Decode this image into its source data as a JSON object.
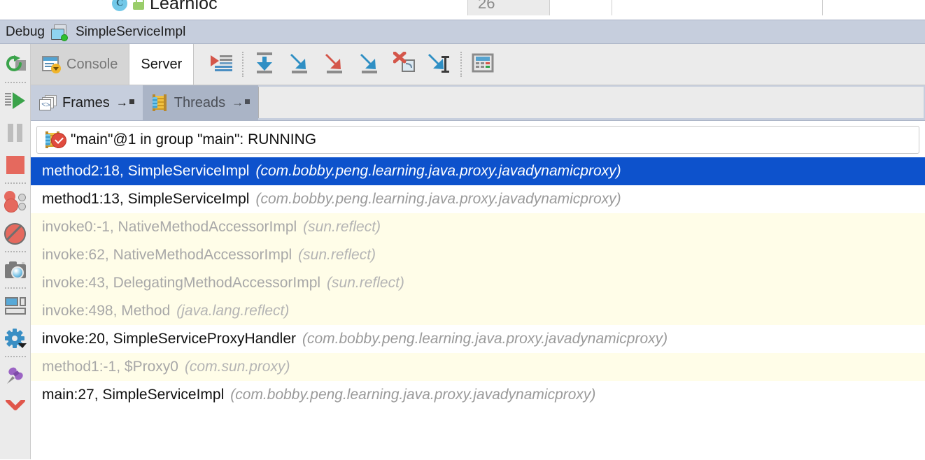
{
  "editor_strip": {
    "class_icon": "class-c-icon",
    "lock_icon": "lock-icon",
    "class_name": "Learnloc",
    "line_number": "26"
  },
  "debug_header": {
    "label": "Debug",
    "session_icon": "debug-session-icon",
    "session_name": "SimpleServiceImpl"
  },
  "side_toolbar": {
    "buttons": [
      {
        "name": "rerun-button",
        "tooltip": "Rerun"
      },
      {
        "name": "resume-program-button",
        "tooltip": "Resume Program"
      },
      {
        "name": "pause-program-button",
        "tooltip": "Pause Program"
      },
      {
        "name": "stop-button",
        "tooltip": "Stop"
      },
      {
        "name": "view-breakpoints-button",
        "tooltip": "View Breakpoints"
      },
      {
        "name": "mute-breakpoints-button",
        "tooltip": "Mute Breakpoints"
      },
      {
        "name": "snapshot-button",
        "tooltip": "Get Thread Dump"
      },
      {
        "name": "restore-layout-button",
        "tooltip": "Restore Layout"
      },
      {
        "name": "settings-button",
        "tooltip": "Settings"
      },
      {
        "name": "pin-tab-button",
        "tooltip": "Pin Tab"
      },
      {
        "name": "collapse-button",
        "tooltip": "Hide"
      }
    ]
  },
  "tabs": {
    "items": [
      {
        "label": "Console",
        "icon": "console-icon",
        "active": false
      },
      {
        "label": "Server",
        "icon": "",
        "active": true
      }
    ]
  },
  "toolbar": {
    "buttons": [
      {
        "name": "show-execution-point-button",
        "label": "Show Execution Point"
      },
      {
        "name": "step-over-button",
        "label": "Step Over"
      },
      {
        "name": "step-into-button",
        "label": "Step Into"
      },
      {
        "name": "force-step-into-button",
        "label": "Force Step Into"
      },
      {
        "name": "step-out-button",
        "label": "Step Out"
      },
      {
        "name": "drop-frame-button",
        "label": "Drop Frame"
      },
      {
        "name": "run-to-cursor-button",
        "label": "Run to Cursor"
      },
      {
        "name": "evaluate-expression-button",
        "label": "Evaluate Expression"
      }
    ]
  },
  "frames_panel": {
    "frames_tab": "Frames",
    "frames_arrow": "→",
    "threads_tab": "Threads",
    "threads_arrow": "→",
    "thread_status": "\"main\"@1 in group \"main\": RUNNING",
    "stack_frames": [
      {
        "method": "method2:18, SimpleServiceImpl",
        "package": "(com.bobby.peng.learning.java.proxy.javadynamicproxy)",
        "style": "selected"
      },
      {
        "method": "method1:13, SimpleServiceImpl",
        "package": "(com.bobby.peng.learning.java.proxy.javadynamicproxy)",
        "style": "user"
      },
      {
        "method": "invoke0:-1, NativeMethodAccessorImpl",
        "package": "(sun.reflect)",
        "style": "library"
      },
      {
        "method": "invoke:62, NativeMethodAccessorImpl",
        "package": "(sun.reflect)",
        "style": "library"
      },
      {
        "method": "invoke:43, DelegatingMethodAccessorImpl",
        "package": "(sun.reflect)",
        "style": "library"
      },
      {
        "method": "invoke:498, Method",
        "package": "(java.lang.reflect)",
        "style": "library"
      },
      {
        "method": "invoke:20, SimpleServiceProxyHandler",
        "package": "(com.bobby.peng.learning.java.proxy.javadynamicproxy)",
        "style": "user"
      },
      {
        "method": "method1:-1, $Proxy0",
        "package": "(com.sun.proxy)",
        "style": "library"
      },
      {
        "method": "main:27, SimpleServiceImpl",
        "package": "(com.bobby.peng.learning.java.proxy.javadynamicproxy)",
        "style": "user"
      }
    ]
  },
  "colors": {
    "selection_blue": "#0d52cc",
    "library_yellow": "#fffde8",
    "header_blue_grey": "#c6cedd",
    "toolbar_grey": "#ebebeb"
  }
}
